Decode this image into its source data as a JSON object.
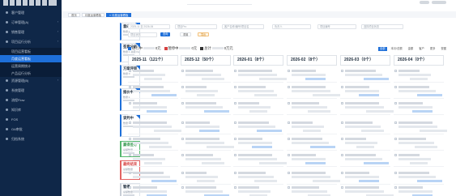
{
  "sidebar": {
    "items": [
      {
        "label": "客户管理",
        "icon": "user-icon",
        "sub": false,
        "active": false
      },
      {
        "label": "订单管理(A)",
        "icon": "order-icon",
        "sub": false,
        "active": false
      },
      {
        "label": "销售管理",
        "icon": "sales-icon",
        "sub": false,
        "active": false
      },
      {
        "label": "项目运行分析",
        "icon": "chart-icon",
        "sub": false,
        "active": false
      },
      {
        "label": "项目运营看板",
        "icon": "",
        "sub": true,
        "active": false
      },
      {
        "label": "月度运营看板",
        "icon": "",
        "sub": true,
        "active": true
      },
      {
        "label": "运营周期统计",
        "icon": "",
        "sub": true,
        "active": false
      },
      {
        "label": "产品运行分析",
        "icon": "",
        "sub": true,
        "active": false
      },
      {
        "label": "资源管理(B)",
        "icon": "resource-icon",
        "sub": false,
        "active": false
      },
      {
        "label": "系统管理",
        "icon": "system-icon",
        "sub": false,
        "active": false
      },
      {
        "label": "流程Flow",
        "icon": "flow-icon",
        "sub": false,
        "active": false
      },
      {
        "label": "知识库",
        "icon": "book-icon",
        "sub": false,
        "active": false
      },
      {
        "label": "FOS",
        "icon": "dollar-icon",
        "sub": false,
        "active": false
      },
      {
        "label": "OA审批",
        "icon": "approve-icon",
        "sub": false,
        "active": false
      },
      {
        "label": "归档系统",
        "icon": "archive-icon",
        "sub": false,
        "active": false
      }
    ]
  },
  "tabs": [
    {
      "label": "首页",
      "on": false
    },
    {
      "label": "月度运营看板",
      "on": false
    },
    {
      "label": "× 月度运营看板",
      "on": true
    }
  ],
  "cards": [
    {
      "title": "意向商谈",
      "sub": "数量:1",
      "kind": "blue"
    },
    {
      "title": "签意分析",
      "sub": "数量:1 总额:¥w",
      "kind": "blue"
    },
    {
      "title": "方案评审",
      "sub": "数量:0",
      "kind": "blue"
    },
    {
      "title": "报价中",
      "sub": "数量:1",
      "kind": "blue"
    },
    {
      "title": "谈判中",
      "sub": "数量:3",
      "kind": "blue"
    },
    {
      "title": "赢得签订",
      "sub": "总额数量",
      "kind": "green"
    },
    {
      "title": "最终结束",
      "sub": "总额数量",
      "kind": "red"
    },
    {
      "title": "暂停",
      "sub": "总额数量",
      "kind": "gray"
    }
  ],
  "filters": {
    "date_range": "2025-11 至 2026-06",
    "f2": "项目Pro",
    "f3": "客户名称/编号/项目名",
    "f4": "负责人",
    "f5": "项目编号",
    "f6": "选择项目状态",
    "f7": "项目状态",
    "search_label": "查询",
    "reset_label": "重置",
    "export_label": "导出"
  },
  "legend": {
    "items": [
      {
        "label": "进行中",
        "value": "0元",
        "color": "#1e6fd9"
      },
      {
        "label": "暂停中",
        "value": "0元",
        "color": "#d64040"
      },
      {
        "label": "总计",
        "value": "0万元",
        "color": "#333333"
      }
    ]
  },
  "viewbar": [
    "全部",
    "本月/总额",
    "金额",
    "客户",
    "更多",
    "视图"
  ],
  "columns": [
    {
      "label": "2025-11（121个）"
    },
    {
      "label": "2025-12（50个）"
    },
    {
      "label": "2026-01（8个）"
    },
    {
      "label": "2026-02（8个）"
    },
    {
      "label": "2026-03（0个）"
    },
    {
      "label": "2026-04（0个）"
    }
  ],
  "topbar": {
    "brand": "客户运营平台"
  }
}
